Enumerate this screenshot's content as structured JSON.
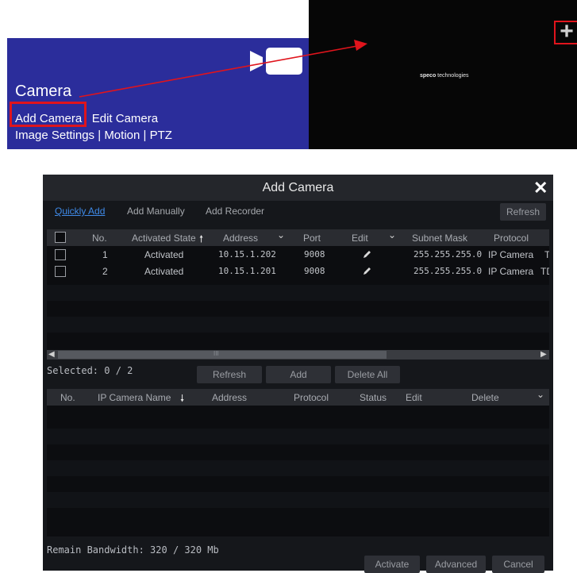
{
  "camera_panel": {
    "title": "Camera",
    "link_add": "Add Camera",
    "link_edit": "Edit Camera",
    "link_image": "Image Settings",
    "sep1": "|",
    "link_motion": "Motion",
    "sep2": "|",
    "link_ptz": "PTZ",
    "icon": "video-camera-icon"
  },
  "live_view": {
    "logo_brand": "speco",
    "logo_rest": " technologies",
    "plus": "+"
  },
  "dialog": {
    "title": "Add Camera",
    "close": "✕",
    "tabs": [
      "Quickly Add",
      "Add Manually",
      "Add Recorder"
    ],
    "refresh_top": "Refresh",
    "grid1_headers": {
      "no": "No.",
      "state": "Activated State",
      "state_sort": "🠕",
      "address": "Address",
      "address_dd": "⌄",
      "port": "Port",
      "edit": "Edit",
      "edit_dd": "⌄",
      "mask": "Subnet Mask",
      "protocol": "Protocol"
    },
    "grid1_rows": [
      {
        "no": "1",
        "state": "Activated",
        "address": "10.15.1.202",
        "port": "9008",
        "mask": "255.255.255.0",
        "protocol": "IP Camera",
        "overflow": "T"
      },
      {
        "no": "2",
        "state": "Activated",
        "address": "10.15.1.201",
        "port": "9008",
        "mask": "255.255.255.0",
        "protocol": "IP Camera",
        "overflow": "TD"
      }
    ],
    "scroll_thumb": "III",
    "selected": "Selected: 0 / 2",
    "btn_refresh": "Refresh",
    "btn_add": "Add",
    "btn_delete_all": "Delete All",
    "grid2_headers": {
      "no": "No.",
      "name": "IP Camera Name",
      "name_sort": "🠗",
      "address": "Address",
      "protocol": "Protocol",
      "status": "Status",
      "edit": "Edit",
      "delete": "Delete",
      "dd": "⌄"
    },
    "bandwidth": "Remain Bandwidth: 320 / 320 Mb",
    "btn_activate": "Activate",
    "btn_advanced": "Advanced",
    "btn_cancel": "Cancel"
  },
  "colors": {
    "panel_blue": "#2b2d9b",
    "highlight_red": "#e0141c",
    "link_active": "#3f8ae8"
  }
}
